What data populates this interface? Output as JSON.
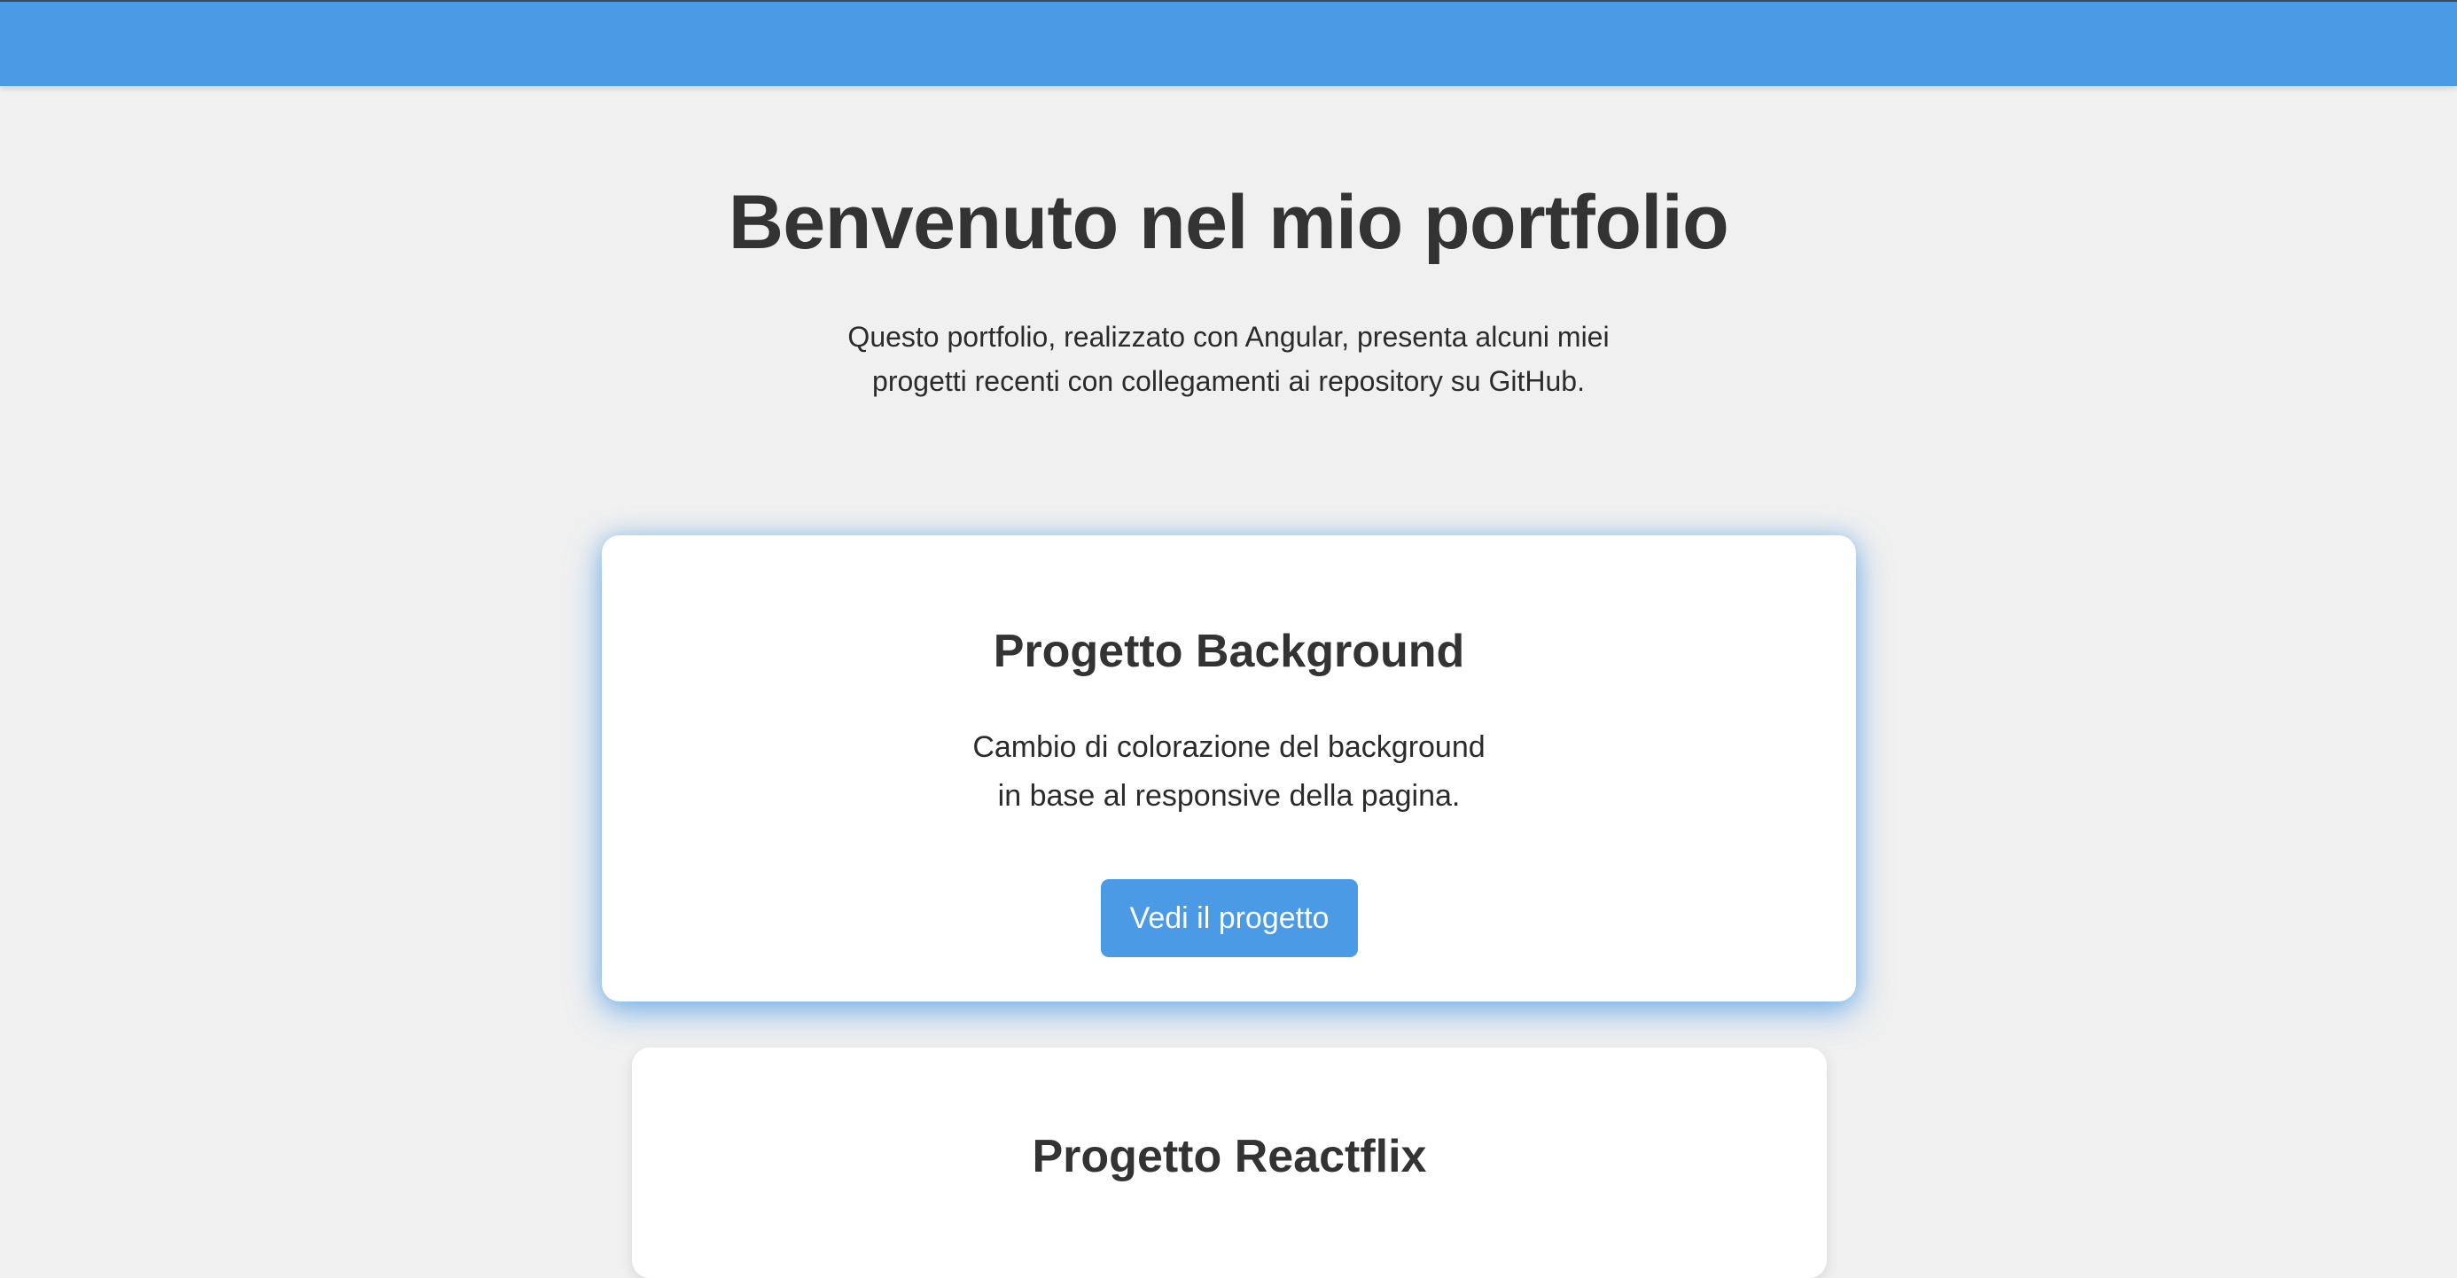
{
  "hero": {
    "title": "Benvenuto nel mio portfolio",
    "subtitle_line1": "Questo portfolio, realizzato con Angular, presenta alcuni miei",
    "subtitle_line2": "progetti recenti con collegamenti ai repository su GitHub."
  },
  "projects": [
    {
      "title": "Progetto Background",
      "description_line1": "Cambio di colorazione del background",
      "description_line2": "in base al responsive della pagina.",
      "button_label": "Vedi il progetto"
    },
    {
      "title": "Progetto Reactflix"
    }
  ],
  "colors": {
    "accent": "#4a9ae6",
    "background": "#f0f0f0",
    "card": "#ffffff",
    "text": "#333333"
  }
}
